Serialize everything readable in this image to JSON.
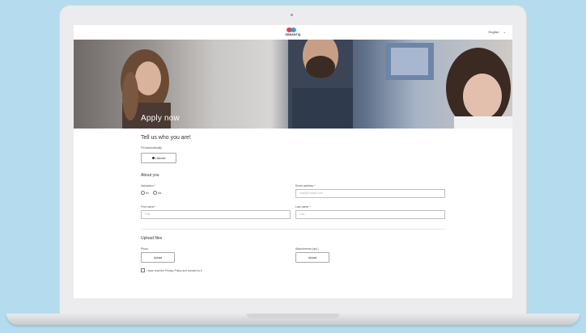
{
  "header": {
    "logo_text": "SEMANTiQ",
    "language": "English",
    "language_chevron": "chevron-down-icon"
  },
  "hero": {
    "title": "Apply now"
  },
  "form": {
    "heading": "Tell us who you are!",
    "fill_automatically_label": "Fill automatically",
    "fill_button": "LinkedIn",
    "about_section": "About you",
    "salutation_label": "Salutation *",
    "salutation_options": [
      "Mr",
      "Ms"
    ],
    "email_label": "Email address *",
    "email_placeholder": "mail@example.com",
    "first_name_label": "First name *",
    "first_name_placeholder": "First",
    "last_name_label": "Last name *",
    "last_name_placeholder": "Last",
    "upload_section": "Upload files",
    "photo_label": "Photo",
    "photo_button": "Upload",
    "attachments_label": "Attachments (opt.)",
    "attachments_button": "Upload",
    "consent_text": "I have read the Privacy Policy and consent to it"
  },
  "colors": {
    "accent_red": "#e4424d",
    "accent_blue": "#2e8fd6",
    "background": "#b4dcee"
  }
}
